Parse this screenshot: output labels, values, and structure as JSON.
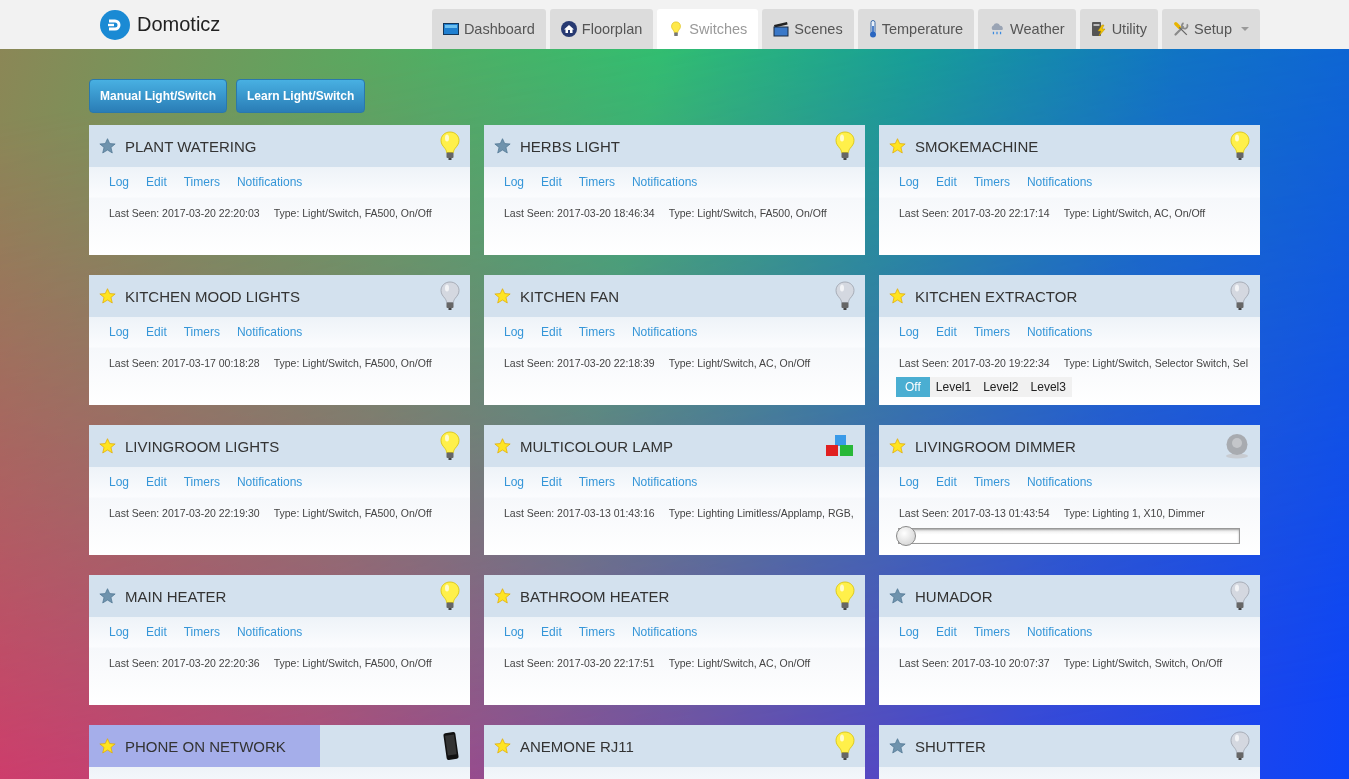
{
  "header": {
    "title": "Domoticz",
    "tabs": [
      {
        "label": "Dashboard",
        "selected": false,
        "dropdown": false
      },
      {
        "label": "Floorplan",
        "selected": false,
        "dropdown": false
      },
      {
        "label": "Switches",
        "selected": true,
        "dropdown": false
      },
      {
        "label": "Scenes",
        "selected": false,
        "dropdown": false
      },
      {
        "label": "Temperature",
        "selected": false,
        "dropdown": false
      },
      {
        "label": "Weather",
        "selected": false,
        "dropdown": false
      },
      {
        "label": "Utility",
        "selected": false,
        "dropdown": false
      },
      {
        "label": "Setup",
        "selected": false,
        "dropdown": true
      }
    ]
  },
  "actions": [
    "Manual Light/Switch",
    "Learn Light/Switch"
  ],
  "cards": [
    {
      "name": "PLANT WATERING",
      "favorite": false,
      "highlighted": false,
      "kind": "switch",
      "on": true,
      "links": [
        "Log",
        "Edit",
        "Timers",
        "Notifications"
      ],
      "last_seen": "Last Seen: 2017-03-20 22:20:03",
      "type": "Type: Light/Switch, FA500, On/Off"
    },
    {
      "name": "HERBS LIGHT",
      "favorite": false,
      "highlighted": false,
      "kind": "switch",
      "on": true,
      "links": [
        "Log",
        "Edit",
        "Timers",
        "Notifications"
      ],
      "last_seen": "Last Seen: 2017-03-20 18:46:34",
      "type": "Type: Light/Switch, FA500, On/Off"
    },
    {
      "name": "SMOKEMACHINE",
      "favorite": true,
      "highlighted": false,
      "kind": "switch",
      "on": true,
      "links": [
        "Log",
        "Edit",
        "Timers",
        "Notifications"
      ],
      "last_seen": "Last Seen: 2017-03-20 22:17:14",
      "type": "Type: Light/Switch, AC, On/Off"
    },
    {
      "name": "KITCHEN MOOD LIGHTS",
      "favorite": true,
      "highlighted": false,
      "kind": "switch",
      "on": false,
      "links": [
        "Log",
        "Edit",
        "Timers",
        "Notifications"
      ],
      "last_seen": "Last Seen: 2017-03-17 00:18:28",
      "type": "Type: Light/Switch, FA500, On/Off"
    },
    {
      "name": "KITCHEN FAN",
      "favorite": true,
      "highlighted": false,
      "kind": "switch",
      "on": false,
      "links": [
        "Log",
        "Edit",
        "Timers",
        "Notifications"
      ],
      "last_seen": "Last Seen: 2017-03-20 22:18:39",
      "type": "Type: Light/Switch, AC, On/Off"
    },
    {
      "name": "KITCHEN EXTRACTOR",
      "favorite": true,
      "highlighted": false,
      "kind": "selector",
      "on": false,
      "links": [
        "Log",
        "Edit",
        "Timers",
        "Notifications"
      ],
      "last_seen": "Last Seen: 2017-03-20 19:22:34",
      "type": "Type: Light/Switch, Selector Switch, Sel",
      "levels": [
        {
          "label": "Off",
          "selected": true
        },
        {
          "label": "Level1",
          "selected": false
        },
        {
          "label": "Level2",
          "selected": false
        },
        {
          "label": "Level3",
          "selected": false
        }
      ]
    },
    {
      "name": "LIVINGROOM LIGHTS",
      "favorite": true,
      "highlighted": false,
      "kind": "switch",
      "on": true,
      "links": [
        "Log",
        "Edit",
        "Timers",
        "Notifications"
      ],
      "last_seen": "Last Seen: 2017-03-20 22:19:30",
      "type": "Type: Light/Switch, FA500, On/Off"
    },
    {
      "name": "MULTICOLOUR LAMP",
      "favorite": true,
      "highlighted": false,
      "kind": "rgb",
      "links": [
        "Log",
        "Edit",
        "Timers",
        "Notifications"
      ],
      "last_seen": "Last Seen: 2017-03-13 01:43:16",
      "type": "Type: Lighting Limitless/Applamp, RGB,"
    },
    {
      "name": "LIVINGROOM DIMMER",
      "favorite": true,
      "highlighted": false,
      "kind": "dimmer",
      "on": false,
      "level": 0,
      "links": [
        "Log",
        "Edit",
        "Timers",
        "Notifications"
      ],
      "last_seen": "Last Seen: 2017-03-13 01:43:54",
      "type": "Type: Lighting 1, X10, Dimmer"
    },
    {
      "name": "MAIN HEATER",
      "favorite": false,
      "highlighted": false,
      "kind": "switch",
      "on": true,
      "links": [
        "Log",
        "Edit",
        "Timers",
        "Notifications"
      ],
      "last_seen": "Last Seen: 2017-03-20 22:20:36",
      "type": "Type: Light/Switch, FA500, On/Off"
    },
    {
      "name": "BATHROOM HEATER",
      "favorite": true,
      "highlighted": false,
      "kind": "switch",
      "on": true,
      "links": [
        "Log",
        "Edit",
        "Timers",
        "Notifications"
      ],
      "last_seen": "Last Seen: 2017-03-20 22:17:51",
      "type": "Type: Light/Switch, AC, On/Off"
    },
    {
      "name": "HUMADOR",
      "favorite": false,
      "highlighted": false,
      "kind": "switch",
      "on": false,
      "links": [
        "Log",
        "Edit",
        "Timers",
        "Notifications"
      ],
      "last_seen": "Last Seen: 2017-03-10 20:07:37",
      "type": "Type: Light/Switch, Switch, On/Off"
    },
    {
      "name": "PHONE ON NETWORK",
      "favorite": true,
      "highlighted": true,
      "kind": "presence"
    },
    {
      "name": "ANEMONE RJ11",
      "favorite": true,
      "highlighted": false,
      "kind": "switch",
      "on": true
    },
    {
      "name": "SHUTTER",
      "favorite": false,
      "highlighted": false,
      "kind": "switch",
      "on": false
    }
  ]
}
